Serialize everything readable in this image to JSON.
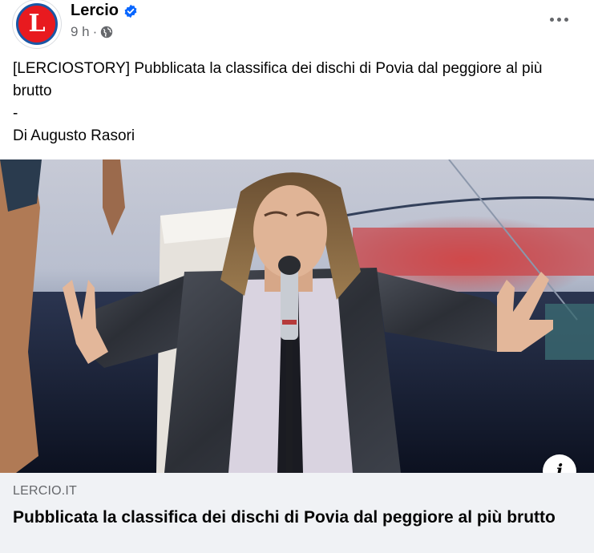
{
  "header": {
    "page_name": "Lercio",
    "avatar_letter": "L",
    "time": "9 h",
    "separator": "·",
    "verified_icon": "verified-badge-icon",
    "audience_icon": "globe-icon",
    "more_icon": "more-options-icon"
  },
  "post": {
    "text_line1": "[LERCIOSTORY] Pubblicata la classifica dei dischi di Povia dal peggiore al più brutto",
    "text_line2": "-",
    "text_line3": "Di Augusto Rasori"
  },
  "link": {
    "domain": "LERCIO.IT",
    "title": "Pubblicata la classifica dei dischi di Povia dal peggiore al più brutto",
    "info_icon": "info-icon",
    "info_glyph": "i"
  },
  "colors": {
    "brand_red": "#e81a1f",
    "brand_blue": "#1a57a6",
    "verified_blue": "#0866ff",
    "secondary_text": "#65676b",
    "footer_bg": "#f0f2f5"
  }
}
